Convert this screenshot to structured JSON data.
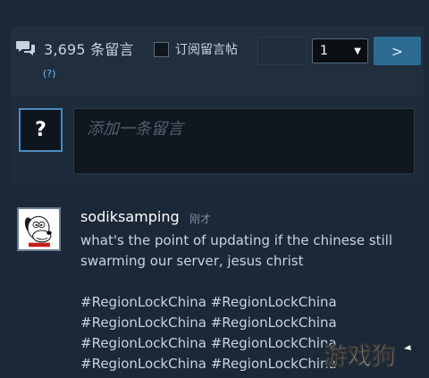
{
  "thread": {
    "count_text": "3,695 条留言",
    "help_link": "(?)",
    "subscribe_label": "订阅留言帖",
    "subscribe_checked": false,
    "page_selected": "1",
    "go_label": ">"
  },
  "compose": {
    "avatar_placeholder": "?",
    "placeholder": "添加一条留言"
  },
  "comment": {
    "author": "sodiksamping",
    "time": "刚才",
    "lines": [
      "what's the point of updating if the chinese still",
      "swarming our server, jesus christ"
    ],
    "hashtags": [
      "#RegionLockChina #RegionLockChina",
      "#RegionLockChina #RegionLockChina",
      "#RegionLockChina #RegionLockChina",
      "#RegionLockChina #RegionLockChina"
    ]
  },
  "watermark": {
    "text": "游戏狗"
  },
  "colors": {
    "background": "#1b2838",
    "panel": "#202e3e",
    "link": "#66c0f4",
    "button": "#2d6a94"
  },
  "icons": {
    "comments": "chat-bubbles-icon",
    "caret": "caret-down-icon"
  }
}
